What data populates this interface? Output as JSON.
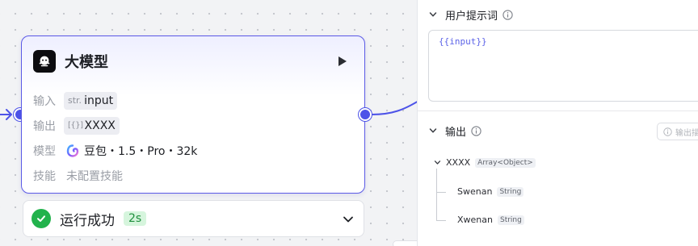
{
  "node": {
    "title": "大模型",
    "rows": {
      "input": {
        "key": "输入",
        "type": "str.",
        "value": "input"
      },
      "output": {
        "key": "输出",
        "type": "[{}]",
        "value": "XXXX"
      },
      "model": {
        "key": "模型",
        "value": "豆包・1.5・Pro・32k"
      },
      "skills": {
        "key": "技能",
        "value": "未配置技能"
      }
    }
  },
  "status": {
    "text": "运行成功",
    "duration": "2s"
  },
  "panel": {
    "prompt_section": {
      "title": "用户提示词",
      "value": "{{input}}"
    },
    "output_section": {
      "title": "输出",
      "description_button": "输出描",
      "tree": [
        {
          "name": "XXXX",
          "type": "Array<Object>"
        },
        {
          "name": "Swenan",
          "type": "String"
        },
        {
          "name": "Xwenan",
          "type": "String"
        }
      ]
    }
  },
  "colors": {
    "accent": "#4d53e8",
    "success": "#22b24c",
    "badge_bg": "#d6f5dd",
    "node_border": "#5b5ae6"
  },
  "icons": [
    "arrow-right-icon",
    "model-node-icon",
    "play-icon",
    "doubao-logo-icon",
    "check-circle-icon",
    "chevron-down-icon",
    "info-icon",
    "caret-down-icon"
  ]
}
